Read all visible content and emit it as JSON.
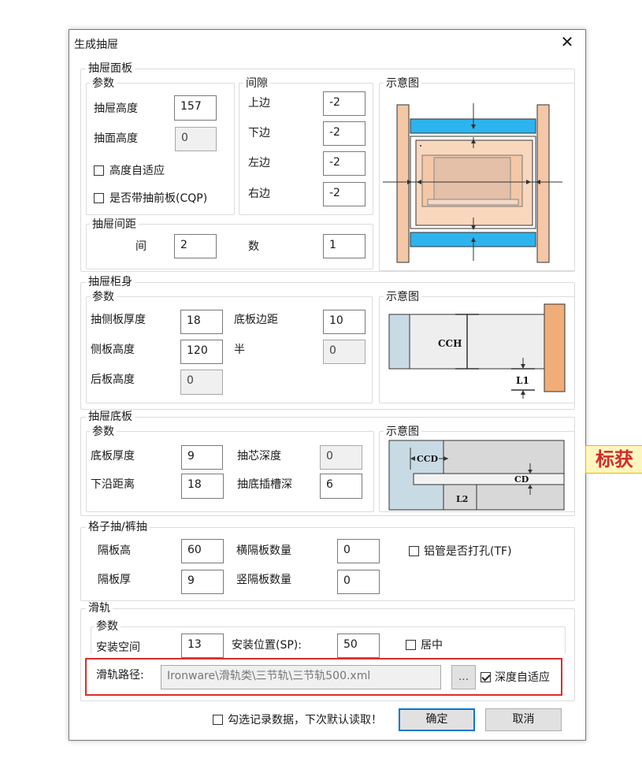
{
  "dialog": {
    "title": "生成抽屉"
  },
  "panel": {
    "title": "抽屉面板",
    "params_title": "参数",
    "drawer_height_label": "抽屉高度",
    "drawer_height": "157",
    "face_height_label": "抽面高度",
    "face_height": "0",
    "auto_height_label": "高度自适应",
    "front_board_label": "是否带抽前板(CQP)",
    "gap_title": "间隙",
    "gap_top_label": "上边",
    "gap_top": "-2",
    "gap_bottom_label": "下边",
    "gap_bottom": "-2",
    "gap_left_label": "左边",
    "gap_left": "-2",
    "gap_right_label": "右边",
    "gap_right": "-2",
    "spacing_title": "抽屉间距",
    "spacing_label": "间",
    "spacing": "2",
    "count_label": "数",
    "count": "1",
    "diagram_title": "示意图"
  },
  "body": {
    "title": "抽屉柜身",
    "params_title": "参数",
    "side_thickness_label": "抽侧板厚度",
    "side_thickness": "18",
    "bottom_margin_label": "底板边距",
    "bottom_margin": "10",
    "side_height_label": "侧板高度",
    "side_height": "120",
    "half_label": "半",
    "half": "0",
    "back_height_label": "后板高度",
    "back_height": "0",
    "diagram_title": "示意图",
    "diagram_cch": "CCH",
    "diagram_l1": "L1"
  },
  "bottom": {
    "title": "抽屉底板",
    "params_title": "参数",
    "thickness_label": "底板厚度",
    "thickness": "9",
    "core_depth_label": "抽芯深度",
    "core_depth": "0",
    "lower_dist_label": "下沿距离",
    "lower_dist": "18",
    "slot_depth_label": "抽底插槽深",
    "slot_depth": "6",
    "diagram_title": "示意图",
    "diagram_ccd": "CCD",
    "diagram_cd": "CD",
    "diagram_l2": "L2"
  },
  "grid": {
    "title": "格子抽/裤抽",
    "div_height_label": "隔板高",
    "div_height": "60",
    "h_count_label": "横隔板数量",
    "h_count": "0",
    "tube_label": "铝管是否打孔(TF)",
    "div_thick_label": "隔板厚",
    "div_thick": "9",
    "v_count_label": "竖隔板数量",
    "v_count": "0"
  },
  "rail": {
    "title": "滑轨",
    "params_title": "参数",
    "space_label": "安装空间",
    "space": "13",
    "pos_label": "安装位置(SP):",
    "pos": "50",
    "center_label": "居中",
    "path_label": "滑轨路径:",
    "path": "Ironware\\滑轨类\\三节轨\\三节轨500.xml",
    "browse_label": "...",
    "auto_depth_label": "深度自适应"
  },
  "footer": {
    "remember_label": "勾选记录数据，下次默认读取！",
    "ok_label": "确定",
    "cancel_label": "取消"
  },
  "side_tag": "标获",
  "colors": {
    "accent": "#0078d7",
    "highlight": "#e02b2b",
    "rail_blue": "#2db4ef",
    "wood": "#f4c7a6",
    "wood_dark": "#f0ad78"
  }
}
